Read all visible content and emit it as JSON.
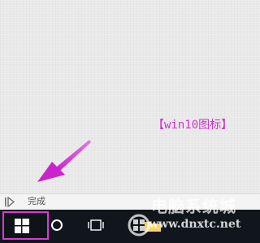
{
  "annotation": {
    "caption": "【win10图标】",
    "color": "#cc33cc"
  },
  "status_bar": {
    "status_text": "完成",
    "icon": "play-step-icon"
  },
  "taskbar": {
    "background": "#10161c",
    "start_button": {
      "icon": "windows-logo-icon",
      "highlight_color": "#d63bd6"
    },
    "search": {
      "icon": "cortana-circle-icon"
    },
    "task_view": {
      "icon": "task-view-icon"
    },
    "pinned": [
      {
        "icon": "folder-icon"
      }
    ]
  },
  "watermark": {
    "brand": "电脑系统城",
    "url": "www.dnxtc.net"
  }
}
